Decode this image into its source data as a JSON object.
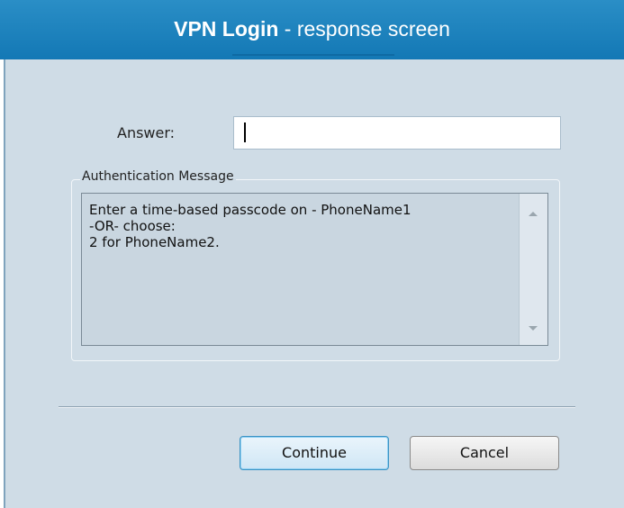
{
  "title": {
    "strong": "VPN Login",
    "light": " - response screen"
  },
  "answer": {
    "label": "Answer:",
    "value": ""
  },
  "auth_message": {
    "legend": "Authentication Message",
    "lines": [
      "Enter a time-based passcode on - PhoneName1",
      "-OR-  choose:",
      "2 for PhoneName2."
    ]
  },
  "buttons": {
    "continue": "Continue",
    "cancel": "Cancel"
  },
  "colors": {
    "title_bar": "#1b83bf",
    "panel": "#cfdce6",
    "continue_border": "#3c93c4"
  }
}
